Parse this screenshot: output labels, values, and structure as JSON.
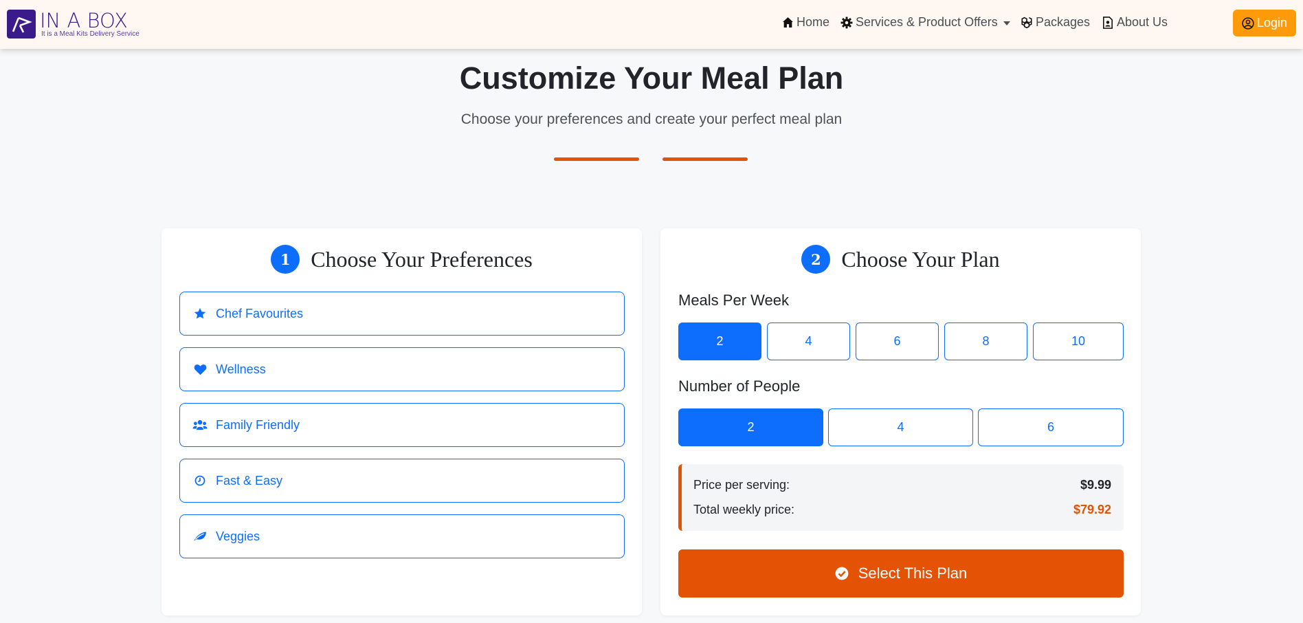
{
  "brand": {
    "name": "IN A BOX",
    "tagline": "It is a Meal Kits Delivery Service"
  },
  "nav": {
    "items": [
      {
        "label": "Home",
        "icon": "home-icon"
      },
      {
        "label": "Services & Product Offers",
        "icon": "gear-icon",
        "dropdown": true
      },
      {
        "label": "Packages",
        "icon": "packages-icon"
      },
      {
        "label": "About Us",
        "icon": "about-icon"
      }
    ],
    "login": "Login"
  },
  "header": {
    "title": "Customize Your Meal Plan",
    "subtitle": "Choose your preferences and create your perfect meal plan"
  },
  "preferences": {
    "step": "1",
    "title": "Choose Your Preferences",
    "items": [
      {
        "label": "Chef Favourites",
        "icon": "star-icon"
      },
      {
        "label": "Wellness",
        "icon": "heart-icon"
      },
      {
        "label": "Family Friendly",
        "icon": "users-icon"
      },
      {
        "label": "Fast & Easy",
        "icon": "clock-icon"
      },
      {
        "label": "Veggies",
        "icon": "leaf-icon"
      }
    ]
  },
  "plan": {
    "step": "2",
    "title": "Choose Your Plan",
    "meals_label": "Meals Per Week",
    "meals_options": [
      "2",
      "4",
      "6",
      "8",
      "10"
    ],
    "meals_selected": "2",
    "people_label": "Number of People",
    "people_options": [
      "2",
      "4",
      "6"
    ],
    "people_selected": "2",
    "price_per_serving_label": "Price per serving:",
    "price_per_serving": "$9.99",
    "total_label": "Total weekly price:",
    "total": "$79.92",
    "select_label": "Select This Plan"
  },
  "colors": {
    "primary": "#0d6efd",
    "accent": "#e35205",
    "brand": "#3b1a8c",
    "login": "#ff9a0a"
  }
}
